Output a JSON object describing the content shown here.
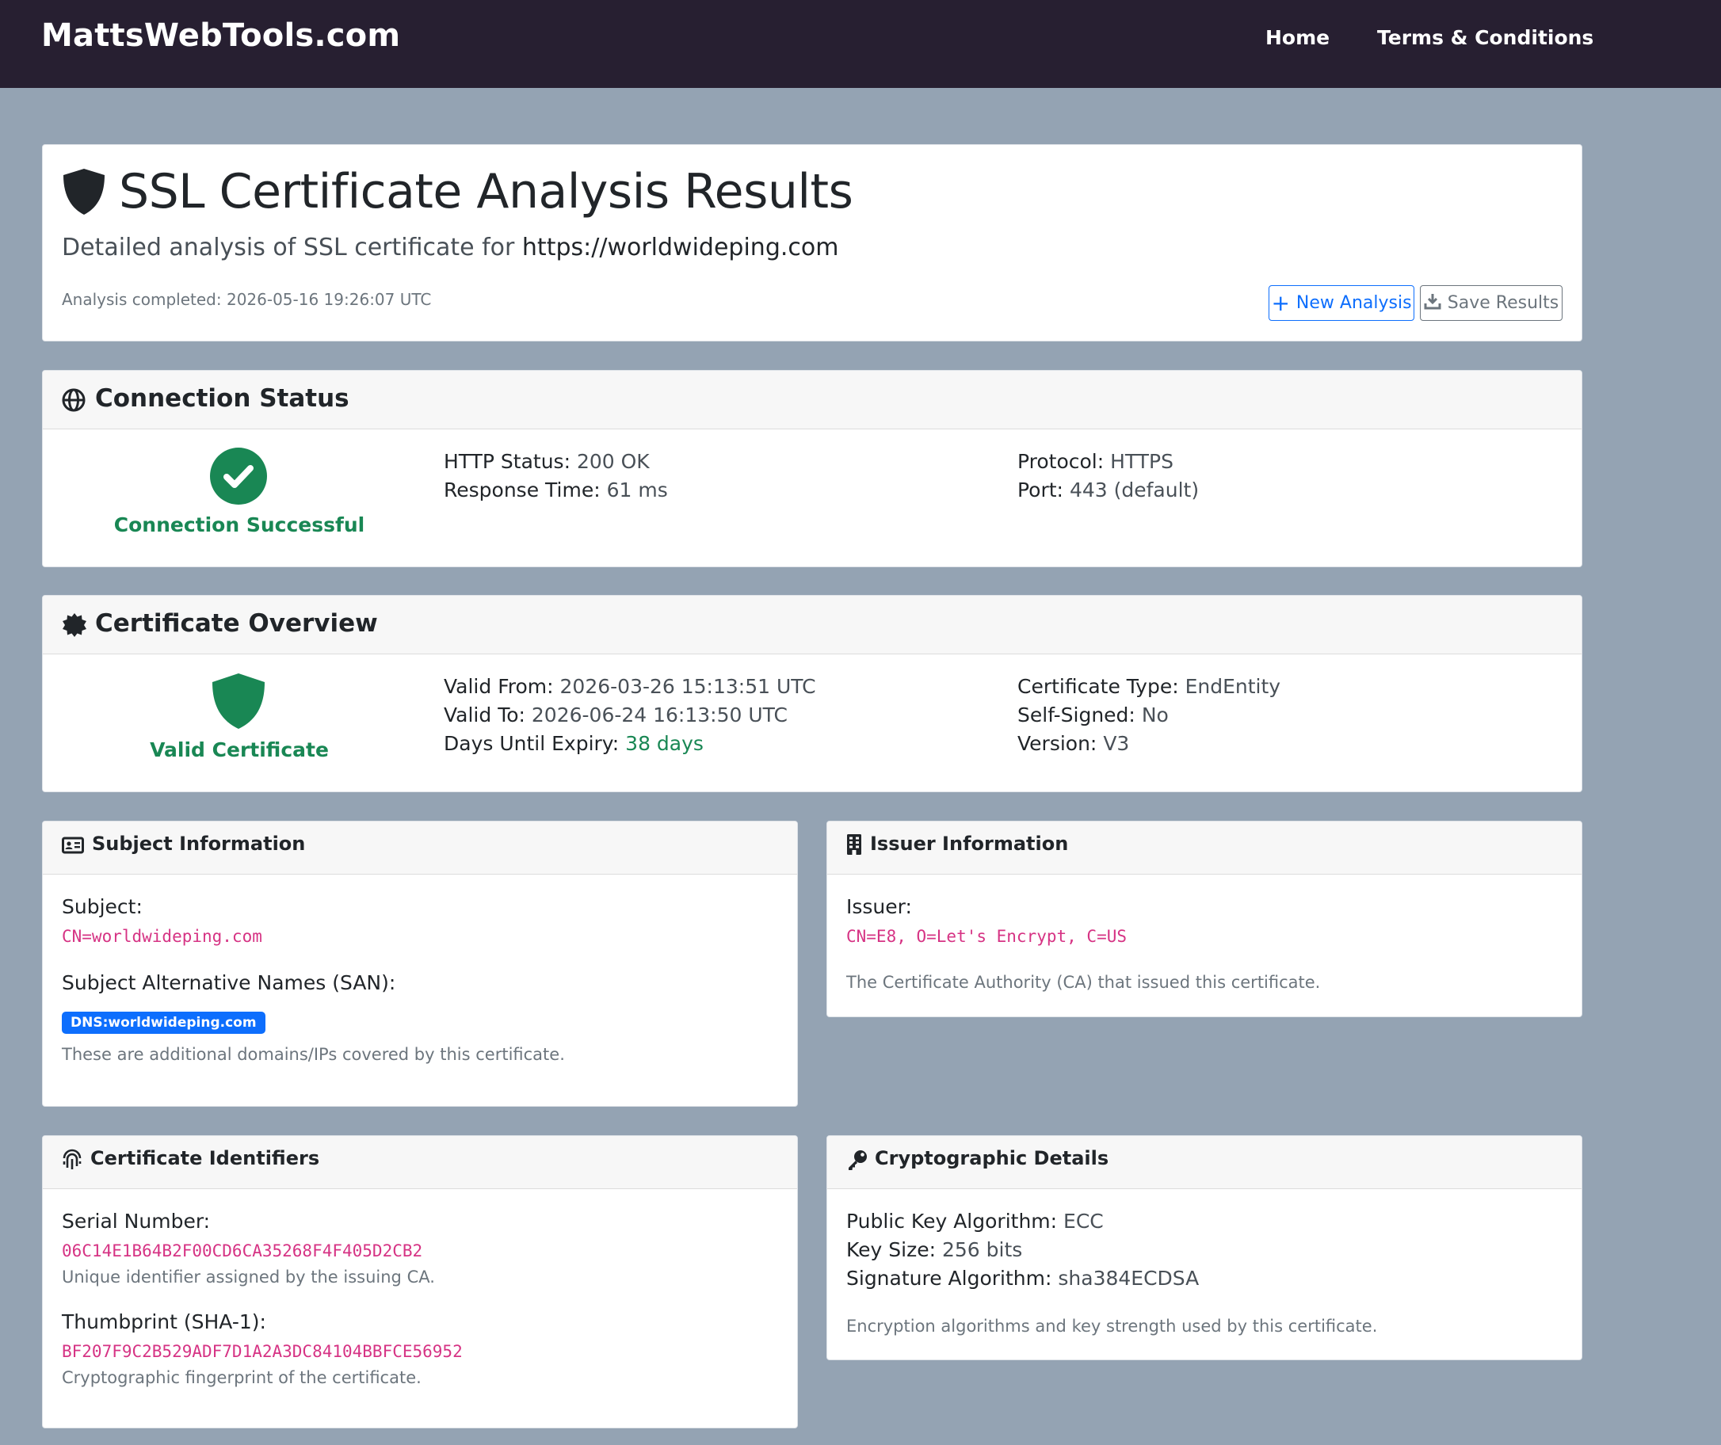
{
  "navbar": {
    "brand": "MattsWebTools.com",
    "links": [
      "Home",
      "Terms & Conditions"
    ]
  },
  "header": {
    "title": "SSL Certificate Analysis Results",
    "subtitle_prefix": "Detailed analysis of SSL certificate for",
    "url": "https://worldwideping.com",
    "completed": "Analysis completed: 2026-05-16 19:26:07 UTC",
    "new_analysis": "New Analysis",
    "save_results": "Save Results"
  },
  "connection": {
    "title": "Connection Status",
    "status": "Connection Successful",
    "http_status_label": "HTTP Status:",
    "http_status": "200 OK",
    "response_time_label": "Response Time:",
    "response_time": "61 ms",
    "protocol_label": "Protocol:",
    "protocol": "HTTPS",
    "port_label": "Port:",
    "port": "443 (default)"
  },
  "overview": {
    "title": "Certificate Overview",
    "status": "Valid Certificate",
    "valid_from_label": "Valid From:",
    "valid_from": "2026-03-26 15:13:51 UTC",
    "valid_to_label": "Valid To:",
    "valid_to": "2026-06-24 16:13:50 UTC",
    "days_label": "Days Until Expiry:",
    "days": "38 days",
    "type_label": "Certificate Type:",
    "type": "EndEntity",
    "self_signed_label": "Self-Signed:",
    "self_signed": "No",
    "version_label": "Version:",
    "version": "V3"
  },
  "subject": {
    "title": "Subject Information",
    "subject_label": "Subject:",
    "subject": "CN=worldwideping.com",
    "san_label": "Subject Alternative Names (SAN):",
    "san_badge": "DNS:worldwideping.com",
    "san_note": "These are additional domains/IPs covered by this certificate."
  },
  "issuer": {
    "title": "Issuer Information",
    "issuer_label": "Issuer:",
    "issuer": "CN=E8, O=Let's Encrypt, C=US",
    "note": "The Certificate Authority (CA) that issued this certificate."
  },
  "identifiers": {
    "title": "Certificate Identifiers",
    "serial_label": "Serial Number:",
    "serial": "06C14E1B64B2F00CD6CA35268F4F405D2CB2",
    "serial_note": "Unique identifier assigned by the issuing CA.",
    "thumb_label": "Thumbprint (SHA-1):",
    "thumb": "BF207F9C2B529ADF7D1A2A3DC84104BBFCE56952",
    "thumb_note": "Cryptographic fingerprint of the certificate."
  },
  "crypto": {
    "title": "Cryptographic Details",
    "pk_label": "Public Key Algorithm:",
    "pk": "ECC",
    "key_size_label": "Key Size:",
    "key_size": "256 bits",
    "sig_label": "Signature Algorithm:",
    "sig": "sha384ECDSA",
    "note": "Encryption algorithms and key strength used by this certificate."
  },
  "colors": {
    "navbar": "#271f31",
    "page_bg": "#94a3b3",
    "success": "#198754",
    "primary": "#0d6efd",
    "code": "#d63384"
  }
}
